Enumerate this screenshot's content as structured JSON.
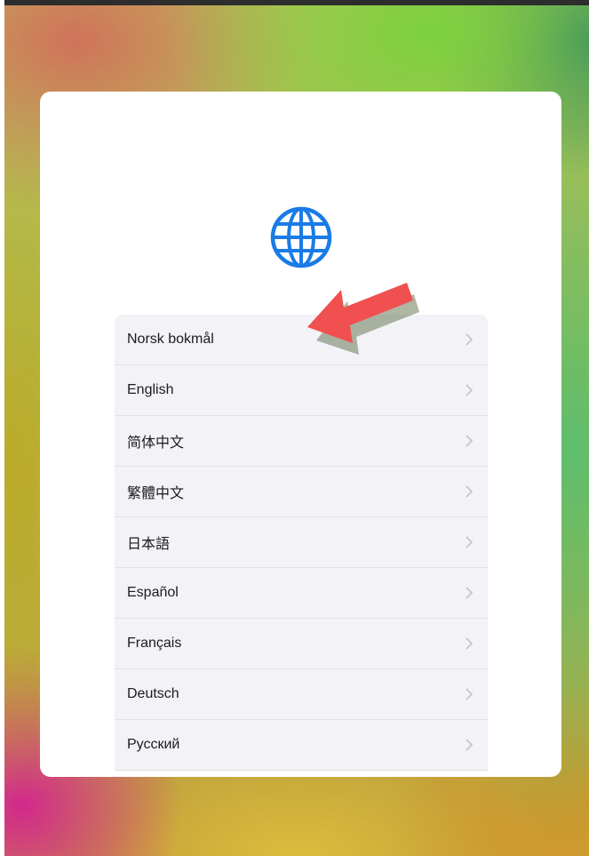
{
  "language_list": {
    "items": [
      {
        "label": "Norsk bokmål"
      },
      {
        "label": "English"
      },
      {
        "label": "简体中文"
      },
      {
        "label": "繁體中文"
      },
      {
        "label": "日本語"
      },
      {
        "label": "Español"
      },
      {
        "label": "Français"
      },
      {
        "label": "Deutsch"
      },
      {
        "label": "Русский"
      }
    ]
  },
  "icons": {
    "globe": "globe-icon",
    "chevron": "chevron-right-icon",
    "annotation": "red-arrow-annotation"
  },
  "colors": {
    "accent": "#1a7be6",
    "arrow": "#f05050",
    "list_background": "#f2f2f7"
  }
}
